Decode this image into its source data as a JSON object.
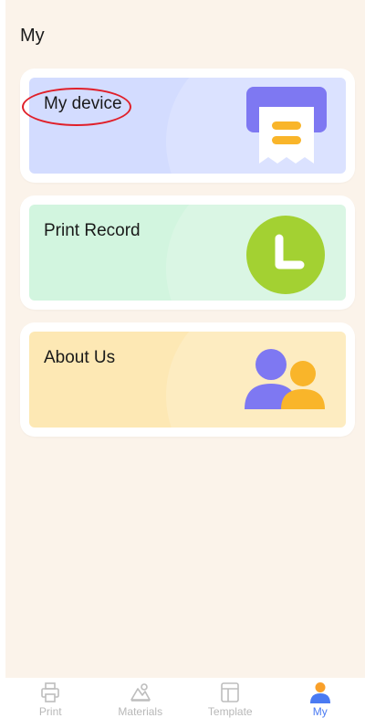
{
  "header": {
    "title": "My"
  },
  "cards": [
    {
      "label": "My device",
      "icon": "printer-receipt-icon",
      "bg": "#d3dcff"
    },
    {
      "label": "Print Record",
      "icon": "clock-icon",
      "bg": "#d2f5df"
    },
    {
      "label": "About Us",
      "icon": "users-icon",
      "bg": "#fde8b4"
    }
  ],
  "tabs": [
    {
      "label": "Print",
      "icon": "printer-icon",
      "active": false
    },
    {
      "label": "Materials",
      "icon": "materials-icon",
      "active": false
    },
    {
      "label": "Template",
      "icon": "template-icon",
      "active": false
    },
    {
      "label": "My",
      "icon": "user-icon",
      "active": true
    }
  ],
  "colors": {
    "background": "#fbf3ea",
    "accent": "#4a7af2",
    "inactive": "#b8b8b8",
    "printer_purple": "#7e78f2",
    "printer_yellow": "#f9b52a",
    "clock_green": "#a3d132",
    "user_purple": "#7e78f2",
    "user_yellow": "#f9b52a",
    "highlight": "#e0202a"
  }
}
